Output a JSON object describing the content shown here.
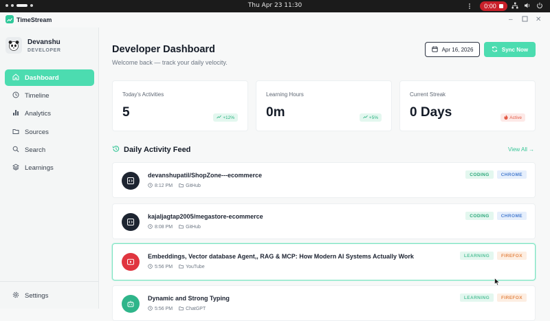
{
  "os": {
    "clock": "Thu Apr 23  11:30",
    "recording_time": "0:00"
  },
  "window": {
    "title": "TimeStream"
  },
  "profile": {
    "name": "Devanshu",
    "role": "DEVELOPER"
  },
  "nav": {
    "items": [
      {
        "label": "Dashboard",
        "icon": "home-icon",
        "active": true
      },
      {
        "label": "Timeline",
        "icon": "clock-icon"
      },
      {
        "label": "Analytics",
        "icon": "bar-chart-icon"
      },
      {
        "label": "Sources",
        "icon": "folder-icon"
      },
      {
        "label": "Search",
        "icon": "search-icon"
      },
      {
        "label": "Learnings",
        "icon": "layers-icon"
      }
    ],
    "settings": "Settings"
  },
  "header": {
    "title": "Developer Dashboard",
    "subtitle": "Welcome back — track your daily velocity.",
    "date": "Apr 16, 2026",
    "sync": "Sync Now"
  },
  "stats": [
    {
      "label": "Today's Activities",
      "value": "5",
      "badge": "+12%",
      "tone": "green"
    },
    {
      "label": "Learning Hours",
      "value": "0m",
      "badge": "+5%",
      "tone": "green"
    },
    {
      "label": "Current Streak",
      "value": "0 Days",
      "badge": "Active",
      "tone": "red"
    }
  ],
  "feed": {
    "title": "Daily Activity Feed",
    "view_all": "View All →",
    "items": [
      {
        "title": "devanshupatil/ShopZone---ecommerce",
        "time": "8:12 PM",
        "source": "GitHub",
        "tags": [
          "CODING",
          "CHROME"
        ],
        "icon": "code-icon",
        "color": "#1e2531"
      },
      {
        "title": "kajaljagtap2005/megastore-ecommerce",
        "time": "8:08 PM",
        "source": "GitHub",
        "tags": [
          "CODING",
          "CHROME"
        ],
        "icon": "code-icon",
        "color": "#1e2531"
      },
      {
        "title": "Embeddings, Vector database Agent,, RAG & MCP: How Modern AI Systems Actually Work",
        "time": "5:56 PM",
        "source": "YouTube",
        "tags": [
          "LEARNING",
          "FIREFOX"
        ],
        "icon": "play-icon",
        "color": "#e0353f"
      },
      {
        "title": "Dynamic and Strong Typing",
        "time": "5:56 PM",
        "source": "ChatGPT",
        "tags": [
          "LEARNING",
          "FIREFOX"
        ],
        "icon": "bot-icon",
        "color": "#2fb58a"
      }
    ]
  }
}
